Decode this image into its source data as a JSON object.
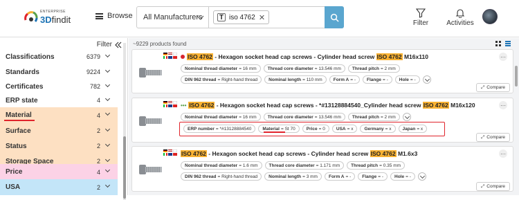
{
  "header": {
    "logo_small": "ENTERPRISE",
    "logo_big_a": "3D",
    "logo_big_b": "findit",
    "browse_label": "Browse",
    "manufacturer_select": "All Manufacturers",
    "search_chip": "iso 4762",
    "chip_close": "✕",
    "filter_label": "Filter",
    "activities_label": "Activities"
  },
  "sidebar": {
    "filter_label": "Filter",
    "items": [
      {
        "label": "Classifications",
        "count": "6379"
      },
      {
        "label": "Standards",
        "count": "9224"
      },
      {
        "label": "Certificates",
        "count": "782"
      },
      {
        "label": "ERP state",
        "count": "4"
      },
      {
        "label": "Material",
        "count": "4"
      },
      {
        "label": "Surface",
        "count": "2"
      },
      {
        "label": "Status",
        "count": "2"
      },
      {
        "label": "Storage Space",
        "count": "2"
      },
      {
        "label": "Price",
        "count": "4"
      },
      {
        "label": "USA",
        "count": "2"
      }
    ],
    "colors": {
      "orange": "#fde0c2",
      "pink": "#fcd2e6",
      "blue": "#c3e5f8"
    }
  },
  "main": {
    "found_text": "~9229 products found",
    "compare_label": "Compare",
    "more_label": "···",
    "products": [
      {
        "t1": "",
        "h1": "ISO 4762",
        "t2": " - Hexagon socket head cap screws - Cylinder head screw ",
        "h2": "ISO 4762",
        "t3": " M16x110",
        "status_color": "#d9262e",
        "row1": [
          {
            "k": "Nominal thread diameter",
            "v": " = 16 mm"
          },
          {
            "k": "Thread core diameter",
            "v": " = 13.546 mm"
          },
          {
            "k": "Thread pitch",
            "v": " = 2 mm"
          }
        ],
        "row2": [
          {
            "k": "DIN 962 thread",
            "v": " = Right-hand thread"
          },
          {
            "k": "Nominal length",
            "v": " = 110 mm"
          },
          {
            "k": "Form A",
            "v": " = -"
          },
          {
            "k": "Flange",
            "v": " = -"
          },
          {
            "k": "Hole",
            "v": " = -"
          }
        ]
      },
      {
        "t1": "",
        "h1": "ISO 4762",
        "t2": " - Hexagon socket head cap screws - *#13128884540_Cylinder head screw ",
        "h2": "ISO 4762",
        "t3": " M16x120",
        "status_dots": "•••",
        "row1": [
          {
            "k": "Nominal thread diameter",
            "v": " = 16 mm"
          },
          {
            "k": "Thread core diameter",
            "v": " = 13.546 mm"
          },
          {
            "k": "Thread pitch",
            "v": " = 2 mm"
          }
        ],
        "row2": [
          {
            "k": "ERP number",
            "v": " = *#13128884540"
          },
          {
            "k": "Material",
            "v": " = St 70"
          },
          {
            "k": "Price",
            "v": " = 0"
          },
          {
            "k": "USA",
            "v": " = x"
          },
          {
            "k": "Germany",
            "v": " = x"
          },
          {
            "k": "Japan",
            "v": " = x"
          }
        ]
      },
      {
        "t1": "",
        "h1": "ISO 4762",
        "t2": " - Hexagon socket head cap screws - Cylinder head screw ",
        "h2": "ISO 4762",
        "t3": " M1.6x3",
        "row1": [
          {
            "k": "Nominal thread diameter",
            "v": " = 1.6 mm"
          },
          {
            "k": "Thread core diameter",
            "v": " = 1.171 mm"
          },
          {
            "k": "Thread pitch",
            "v": " = 0.35 mm"
          }
        ],
        "row2": [
          {
            "k": "DIN 962 thread",
            "v": " = Right-hand thread"
          },
          {
            "k": "Nominal length",
            "v": " = 3 mm"
          },
          {
            "k": "Form A",
            "v": " = -"
          },
          {
            "k": "Flange",
            "v": " = -"
          },
          {
            "k": "Hole",
            "v": " = -"
          }
        ]
      }
    ]
  },
  "accent_color": "#1c73b5",
  "highlight_color": "#f9b233",
  "annotation_color": "#e0232b"
}
